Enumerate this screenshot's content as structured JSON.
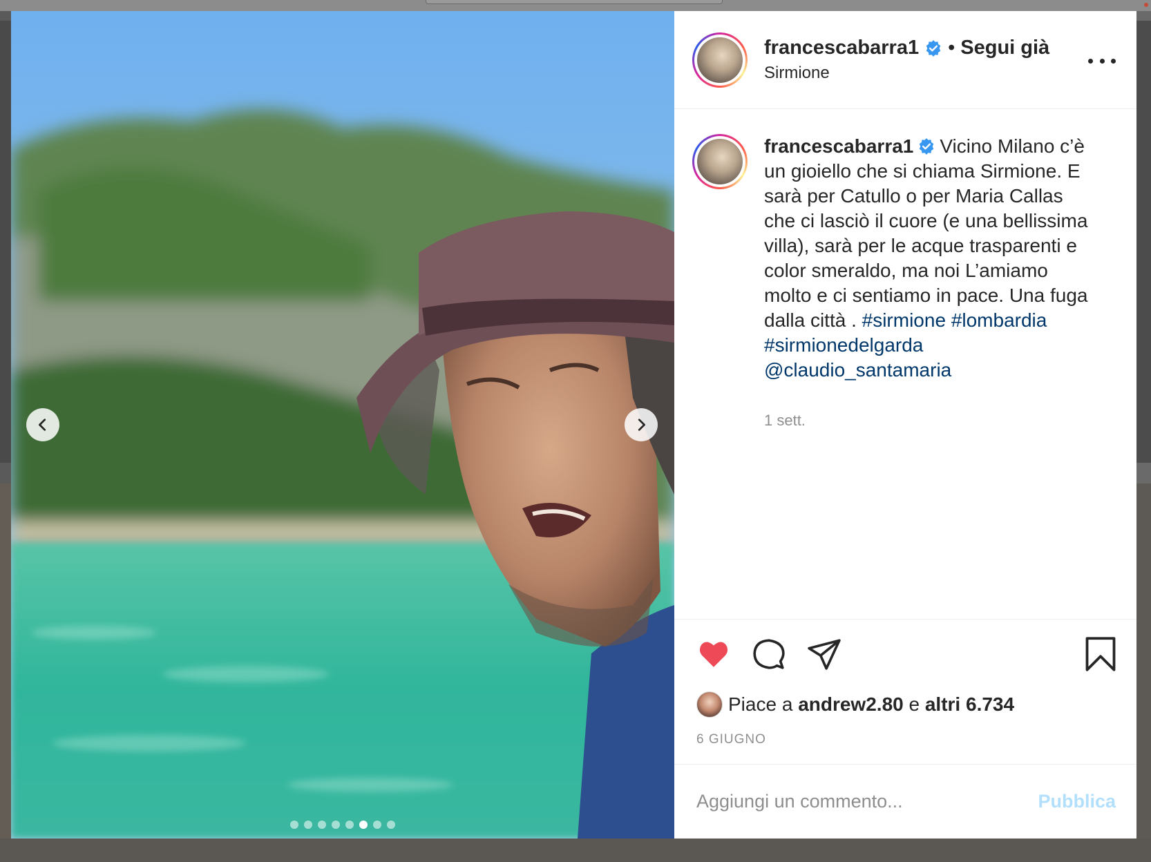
{
  "post": {
    "username": "francescabarra1",
    "follow_separator": "•",
    "follow_state": "Segui già",
    "location": "Sirmione",
    "caption": {
      "text_part1": "Vicino Milano c’è un gioiello che si chiama Sirmione. E sarà per Catullo o per Maria Callas che ci lasciò il cuore (e una bellissima villa), sarà per le acque trasparenti e color smeraldo, ma noi L’amiamo molto e ci sentiamo in pace. Una fuga dalla città .",
      "tags": [
        "#sirmione",
        "#lombardia",
        "#sirmionedelgarda",
        "@claudio_santamaria"
      ]
    },
    "time_ago": "1 sett.",
    "likes": {
      "prefix": "Piace a",
      "user": "andrew2.80",
      "middle": "e",
      "others": "altri 6.734"
    },
    "date": "6 GIUGNO",
    "comment": {
      "placeholder": "Aggiungi un commento...",
      "publish_label": "Pubblica"
    },
    "carousel": {
      "total_slides": 8,
      "active_index": 5
    }
  },
  "icons": {
    "verified": "verified-badge-icon",
    "like": "heart-icon",
    "comment": "comment-icon",
    "share": "share-icon",
    "save": "bookmark-icon",
    "more": "more-options-icon",
    "prev": "chevron-left-icon",
    "next": "chevron-right-icon"
  },
  "colors": {
    "heart": "#ed4956",
    "verified": "#3897f0",
    "tag": "#00376b",
    "publish": "#b2dffc"
  }
}
